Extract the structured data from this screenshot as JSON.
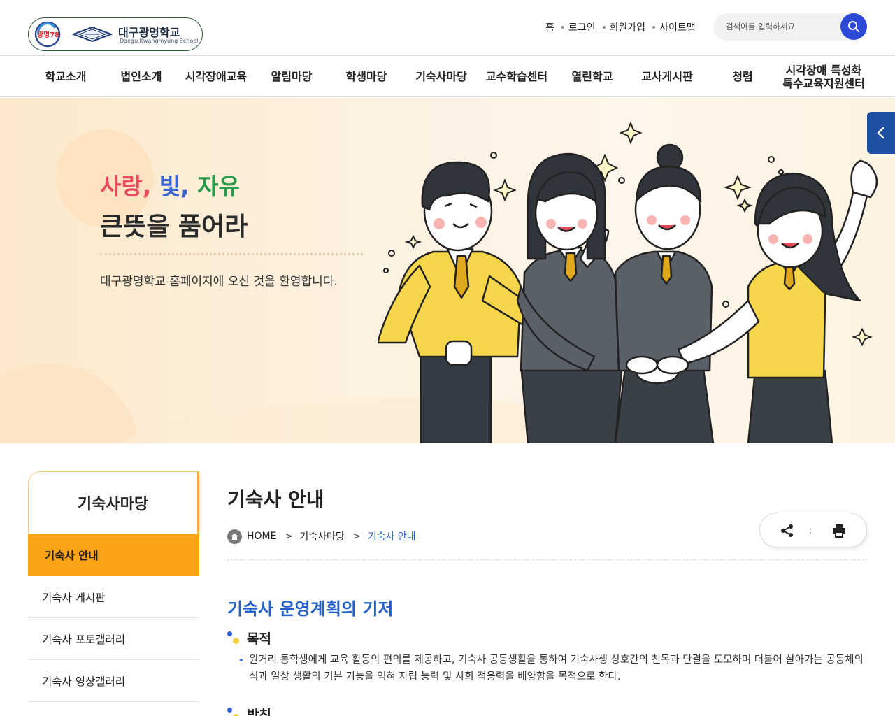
{
  "header": {
    "logo": {
      "emblem_text": "광명78",
      "name_ko": "대구광명학교",
      "name_en": "Daegu Kwangmyung School"
    },
    "util_links": [
      {
        "label": "홈"
      },
      {
        "label": "로그인"
      },
      {
        "label": "회원가입"
      },
      {
        "label": "사이트맵"
      }
    ],
    "search": {
      "placeholder": "검색어를 입력하세요",
      "value": "",
      "icon": "search-icon"
    }
  },
  "gnb": [
    {
      "label": "학교소개"
    },
    {
      "label": "법인소개"
    },
    {
      "label": "시각장애교육"
    },
    {
      "label": "알림마당"
    },
    {
      "label": "학생마당"
    },
    {
      "label": "기숙사마당"
    },
    {
      "label": "교수학습센터"
    },
    {
      "label": "열린학교"
    },
    {
      "label": "교사게시판"
    },
    {
      "label": "청렴"
    },
    {
      "label": "시각장애 특성화\n특수교육지원센터"
    }
  ],
  "visual": {
    "slogan_words": [
      "사랑",
      "빛",
      "자유"
    ],
    "slogan_line2": "큰뜻을 품어라",
    "welcome": "대구광명학교 홈페이지에 오신 것을 환영합니다."
  },
  "lnb": {
    "title": "기숙사마당",
    "items": [
      {
        "label": "기숙사 안내",
        "active": true
      },
      {
        "label": "기숙사 게시판",
        "active": false
      },
      {
        "label": "기숙사 포토갤러리",
        "active": false
      },
      {
        "label": "기숙사 영상갤러리",
        "active": false
      }
    ]
  },
  "content": {
    "page_title": "기숙사 안내",
    "breadcrumb": {
      "home": "HOME",
      "items": [
        "기숙사마당",
        "기숙사 안내"
      ]
    },
    "section_title": "기숙사 운영계획의 기저",
    "subsections": [
      {
        "heading": "목적",
        "text": "원거리 통학생에게 교육 활동의 편의를 제공하고, 기숙사 공동생활을 통하여 기숙사생 상호간의 친목과 단결을 도모하며 더불어 살아가는 공동체의식과 일상 생활의 기본 기능을 익혀 자립 능력 및 사회 적응력을 배양함을 목적으로 한다."
      },
      {
        "heading": "방침"
      }
    ]
  },
  "colors": {
    "accent_blue": "#2b48d6",
    "lnb_active": "#fca317",
    "title_blue": "#2560c9",
    "slogan_red": "#e84a5f",
    "slogan_blue": "#3a63d8",
    "slogan_green": "#2b9a4a"
  }
}
